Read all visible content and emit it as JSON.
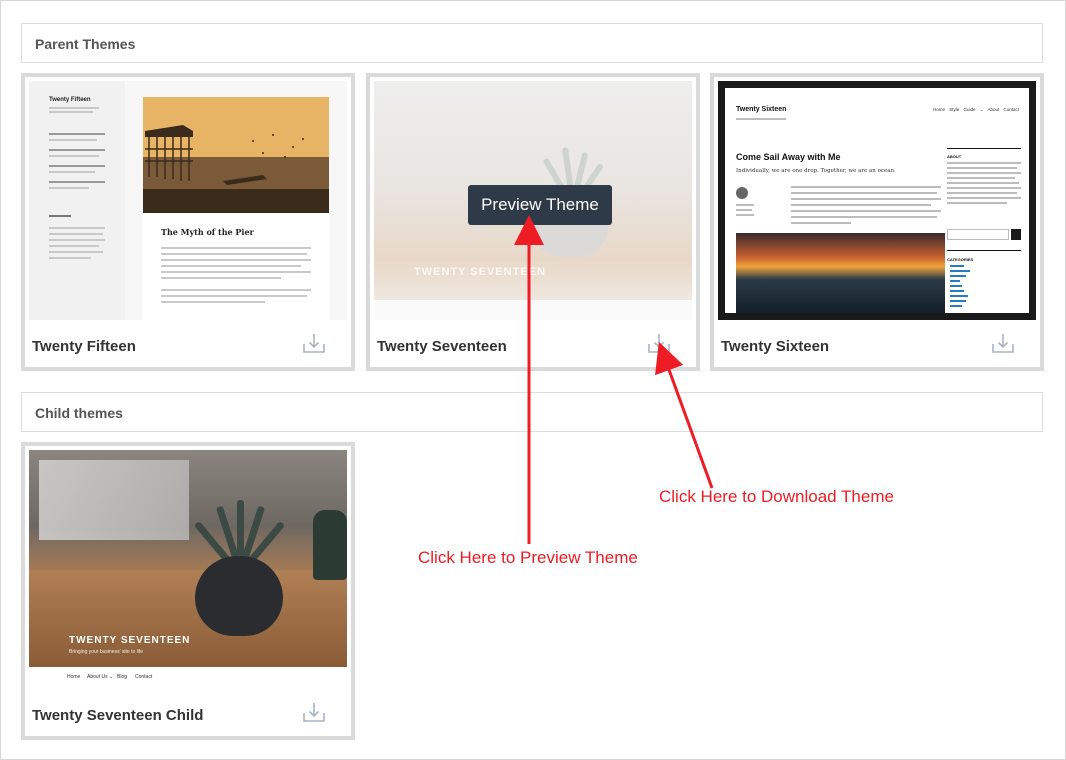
{
  "sections": {
    "parent_label": "Parent Themes",
    "child_label": "Child themes"
  },
  "themes": [
    {
      "name": "Twenty Fifteen",
      "screenshot": {
        "site_title": "Twenty Fifteen",
        "post_title": "The Myth of the Pier"
      }
    },
    {
      "name": "Twenty Seventeen",
      "preview_button": "Preview Theme",
      "screenshot": {
        "watermark": "TWENTY SEVENTEEN"
      }
    },
    {
      "name": "Twenty Sixteen",
      "screenshot": {
        "site_title": "Twenty Sixteen",
        "nav": "Home  Style Guide ⌄  About  Contact",
        "post_title": "Come Sail Away with Me",
        "post_subtitle": "Individually, we are one drop. Together, we are an ocean.",
        "sidebar_about": "ABOUT",
        "sidebar_categories": "CATEGORIES"
      }
    }
  ],
  "child_themes": [
    {
      "name": "Twenty Seventeen Child",
      "screenshot": {
        "watermark": "TWENTY SEVENTEEN",
        "tagline": "Bringing your business' site to life",
        "nav": [
          "Home",
          "About Us ⌄",
          "Blog",
          "Contact"
        ]
      }
    }
  ],
  "annotations": {
    "preview": "Click Here to Preview Theme",
    "download": "Click Here to Download Theme",
    "color": "#ee1c24"
  },
  "icons": {
    "download": "download-icon"
  }
}
